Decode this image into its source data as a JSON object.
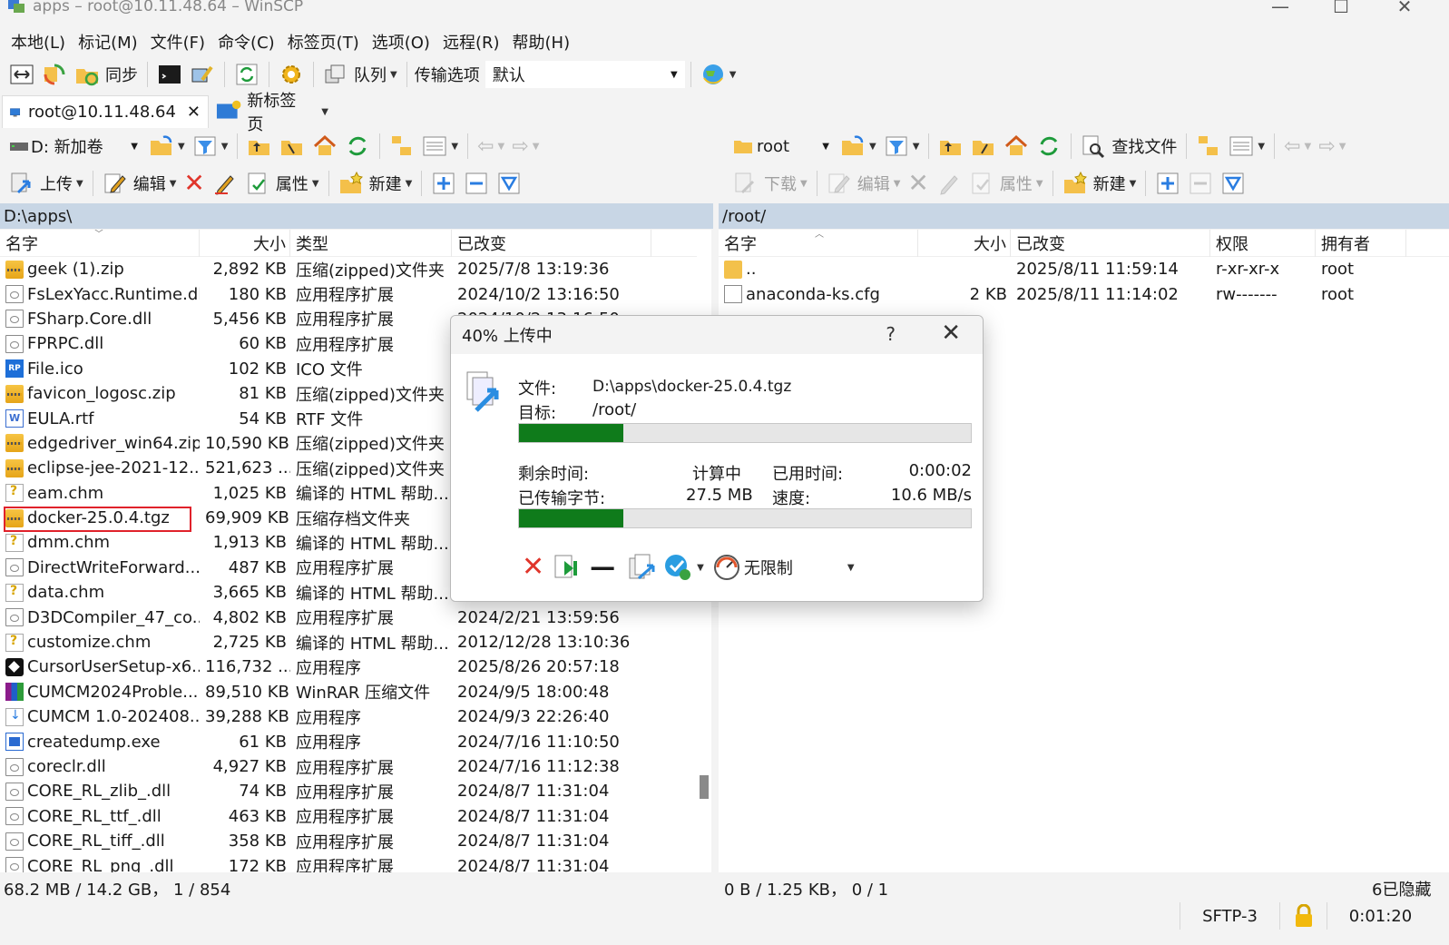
{
  "window": {
    "title": "apps – root@10.11.48.64 – WinSCP"
  },
  "menu": [
    "本地(L)",
    "标记(M)",
    "文件(F)",
    "命令(C)",
    "标签页(T)",
    "选项(O)",
    "远程(R)",
    "帮助(H)"
  ],
  "toolbar": {
    "sync_label": "同步",
    "queue_label": "队列",
    "transfer_options_label": "传输选项",
    "transfer_preset": "默认"
  },
  "tabs": [
    {
      "label": "root@10.11.48.64",
      "close": "✕"
    },
    {
      "label": "新标签页"
    }
  ],
  "left": {
    "drive": "D: 新加卷",
    "path": "D:\\apps\\",
    "upload_label": "上传",
    "edit_label": "编辑",
    "props_label": "属性",
    "new_label": "新建",
    "columns": [
      "名字",
      "大小",
      "类型",
      "已改变"
    ],
    "files": [
      {
        "name": "geek (1).zip",
        "size": "2,892 KB",
        "type": "压缩(zipped)文件夹",
        "date": "2025/7/8 13:19:36",
        "icon": "zip"
      },
      {
        "name": "FsLexYacc.Runtime.dll",
        "size": "180 KB",
        "type": "应用程序扩展",
        "date": "2024/10/2 13:16:50",
        "icon": "dll"
      },
      {
        "name": "FSharp.Core.dll",
        "size": "5,456 KB",
        "type": "应用程序扩展",
        "date": "2024/10/2 13:16:50",
        "icon": "dll"
      },
      {
        "name": "FPRPC.dll",
        "size": "60 KB",
        "type": "应用程序扩展",
        "date": "",
        "icon": "dll"
      },
      {
        "name": "File.ico",
        "size": "102 KB",
        "type": "ICO 文件",
        "date": "",
        "icon": "ico-file"
      },
      {
        "name": "favicon_logosc.zip",
        "size": "81 KB",
        "type": "压缩(zipped)文件夹",
        "date": "",
        "icon": "zip"
      },
      {
        "name": "EULA.rtf",
        "size": "54 KB",
        "type": "RTF 文件",
        "date": "",
        "icon": "rtf"
      },
      {
        "name": "edgedriver_win64.zip",
        "size": "10,590 KB",
        "type": "压缩(zipped)文件夹",
        "date": "",
        "icon": "zip"
      },
      {
        "name": "eclipse-jee-2021-12...",
        "size": "521,623 ...",
        "type": "压缩(zipped)文件夹",
        "date": "",
        "icon": "zip"
      },
      {
        "name": "eam.chm",
        "size": "1,025 KB",
        "type": "编译的 HTML 帮助...",
        "date": "",
        "icon": "chm"
      },
      {
        "name": "docker-25.0.4.tgz",
        "size": "69,909 KB",
        "type": "压缩存档文件夹",
        "date": "",
        "icon": "zip"
      },
      {
        "name": "dmm.chm",
        "size": "1,913 KB",
        "type": "编译的 HTML 帮助...",
        "date": "",
        "icon": "chm"
      },
      {
        "name": "DirectWriteForward...",
        "size": "487 KB",
        "type": "应用程序扩展",
        "date": "",
        "icon": "dll"
      },
      {
        "name": "data.chm",
        "size": "3,665 KB",
        "type": "编译的 HTML 帮助...",
        "date": "",
        "icon": "chm"
      },
      {
        "name": "D3DCompiler_47_co...",
        "size": "4,802 KB",
        "type": "应用程序扩展",
        "date": "2024/2/21 13:59:56",
        "icon": "dll"
      },
      {
        "name": "customize.chm",
        "size": "2,725 KB",
        "type": "编译的 HTML 帮助...",
        "date": "2012/12/28 13:10:36",
        "icon": "chm"
      },
      {
        "name": "CursorUserSetup-x6...",
        "size": "116,732 ...",
        "type": "应用程序",
        "date": "2025/8/26 20:57:18",
        "icon": "exe-dark"
      },
      {
        "name": "CUMCM2024Proble...",
        "size": "89,510 KB",
        "type": "WinRAR 压缩文件",
        "date": "2024/9/5 18:00:48",
        "icon": "rar"
      },
      {
        "name": "CUMCM 1.0-202408...",
        "size": "39,288 KB",
        "type": "应用程序",
        "date": "2024/9/3 22:26:40",
        "icon": "setup"
      },
      {
        "name": "createdump.exe",
        "size": "61 KB",
        "type": "应用程序",
        "date": "2024/7/16 11:10:50",
        "icon": "exe"
      },
      {
        "name": "coreclr.dll",
        "size": "4,927 KB",
        "type": "应用程序扩展",
        "date": "2024/7/16 11:12:38",
        "icon": "dll"
      },
      {
        "name": "CORE_RL_zlib_.dll",
        "size": "74 KB",
        "type": "应用程序扩展",
        "date": "2024/8/7 11:31:04",
        "icon": "dll"
      },
      {
        "name": "CORE_RL_ttf_.dll",
        "size": "463 KB",
        "type": "应用程序扩展",
        "date": "2024/8/7 11:31:04",
        "icon": "dll"
      },
      {
        "name": "CORE_RL_tiff_.dll",
        "size": "358 KB",
        "type": "应用程序扩展",
        "date": "2024/8/7 11:31:04",
        "icon": "dll"
      },
      {
        "name": "CORE_RL_png_.dll",
        "size": "172 KB",
        "type": "应用程序扩展",
        "date": "2024/8/7 11:31:04",
        "icon": "dll"
      }
    ],
    "status": "68.2 MB / 14.2 GB， 1 / 854"
  },
  "right": {
    "dir": "root",
    "path": "/root/",
    "find_label": "查找文件",
    "download_label": "下载",
    "edit_label": "编辑",
    "props_label": "属性",
    "new_label": "新建",
    "columns": [
      "名字",
      "大小",
      "已改变",
      "权限",
      "拥有者"
    ],
    "files": [
      {
        "name": "..",
        "size": "",
        "date": "2025/8/11 11:59:14",
        "perm": "r-xr-xr-x",
        "owner": "root",
        "icon": "folder-up"
      },
      {
        "name": "anaconda-ks.cfg",
        "size": "2 KB",
        "date": "2025/8/11 11:14:02",
        "perm": "rw-------",
        "owner": "root",
        "icon": "cfg"
      }
    ],
    "status": "0 B / 1.25 KB， 0 / 1",
    "hidden_note": "6已隐藏"
  },
  "bottom": {
    "protocol": "SFTP-3",
    "elapsed": "0:01:20"
  },
  "dialog": {
    "title": "40% 上传中",
    "help": "?",
    "file_label": "文件:",
    "file_value": "D:\\apps\\docker-25.0.4.tgz",
    "target_label": "目标:",
    "target_value": "/root/",
    "file_progress": 0.23,
    "remaining_label": "剩余时间:",
    "remaining_value": "计算中",
    "elapsed_label": "已用时间:",
    "elapsed_value": "0:00:02",
    "transferred_label": "已传输字节:",
    "transferred_value": "27.5 MB",
    "speed_label": "速度:",
    "speed_value": "10.6 MB/s",
    "total_progress": 0.23,
    "speed_limit": "无限制"
  }
}
